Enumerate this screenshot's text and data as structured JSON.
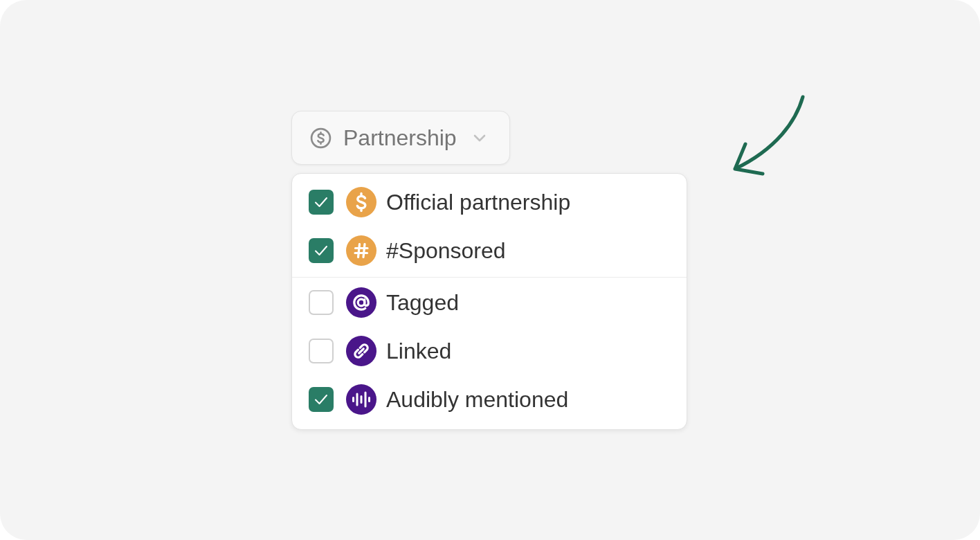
{
  "filter_button": {
    "label": "Partnership"
  },
  "menu": {
    "groups": [
      {
        "items": [
          {
            "label": "Official partnership",
            "checked": true,
            "color": "#e9a349"
          },
          {
            "label": "#Sponsored",
            "checked": true,
            "color": "#e9a349"
          }
        ]
      },
      {
        "items": [
          {
            "label": "Tagged",
            "checked": false,
            "color": "#4a168a"
          },
          {
            "label": "Linked",
            "checked": false,
            "color": "#4a168a"
          },
          {
            "label": "Audibly mentioned",
            "checked": true,
            "color": "#4a168a"
          }
        ]
      }
    ]
  }
}
